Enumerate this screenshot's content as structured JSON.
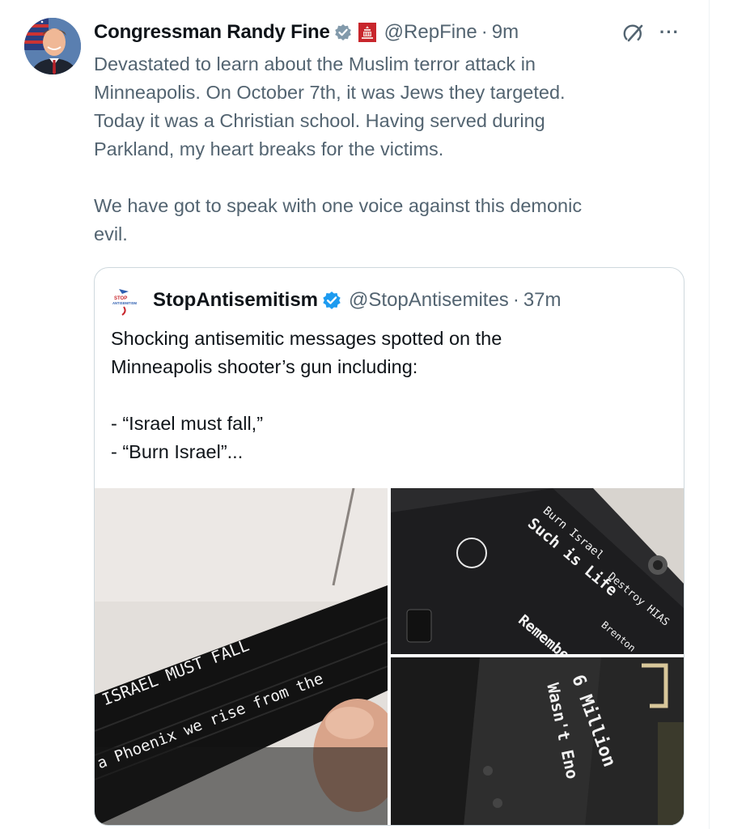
{
  "tweet": {
    "author_name": "Congressman Randy Fine",
    "handle": "@RepFine",
    "separator": "·",
    "time": "9m",
    "text": "Devastated to learn about the Muslim terror attack in\nMinneapolis.   On October 7th, it was Jews they targeted.\nToday it was a Christian school.   Having served during\nParkland, my heart breaks for the victims.\n\nWe have got to speak with one voice against this demonic\nevil.",
    "more_label": "···"
  },
  "quote": {
    "author_name": "StopAntisemitism",
    "handle": "@StopAntisemites",
    "separator": "·",
    "time": "37m",
    "text": "Shocking antisemitic messages spotted on the\nMinneapolis shooter’s gun including:\n\n- “Israel must fall,”\n- “Burn Israel”...",
    "media": {
      "left_text_1": "ISRAEL  MUST  FALL",
      "left_text_2": "a Phoenix we rise from the",
      "tr_text_1": "Burn Israel",
      "tr_text_2": "Such is Life",
      "tr_text_3": "Destroy HIAS",
      "tr_text_4": "Remember Kel",
      "tr_text_5": "Brenton",
      "br_text_1": "6 Million",
      "br_text_2": "Wasn't Eno"
    }
  },
  "colors": {
    "text_primary": "#0f1419",
    "text_secondary": "#536471",
    "verified_gray": "#829aab",
    "verified_blue": "#1d9bf0",
    "border": "#cfd9de"
  },
  "icons": {
    "verified_badge_author": "verified-gray-badge-icon",
    "affiliation": "us-capitol-affiliation-icon",
    "grok": "grok-icon",
    "more": "more-options-icon",
    "verified_badge_quote": "verified-blue-badge-icon"
  }
}
